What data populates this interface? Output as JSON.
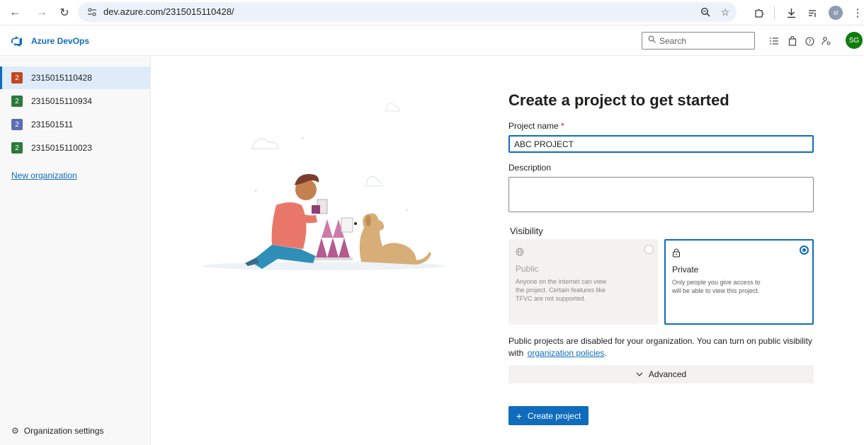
{
  "browser": {
    "url": "dev.azure.com/2315015110428/",
    "profile_initials": "sl"
  },
  "header": {
    "app_title": "Azure DevOps",
    "search_placeholder": "Search",
    "user_initials": "SG"
  },
  "sidebar": {
    "organizations": [
      {
        "badge": "2",
        "name": "2315015110428",
        "color": "#c3471f",
        "selected": true
      },
      {
        "badge": "2",
        "name": "2315015110934",
        "color": "#2b7a3b",
        "selected": false
      },
      {
        "badge": "2",
        "name": "231501511",
        "color": "#5c6db3",
        "selected": false
      },
      {
        "badge": "2",
        "name": "2315015110023",
        "color": "#2b7a3b",
        "selected": false
      }
    ],
    "new_org_label": "New organization",
    "settings_label": "Organization settings"
  },
  "form": {
    "title": "Create a project to get started",
    "project_name_label": "Project name",
    "required_marker": "*",
    "project_name_value": "ABC PROJECT",
    "description_label": "Description",
    "description_value": "",
    "visibility_label": "Visibility",
    "public": {
      "title": "Public",
      "description": "Anyone on the internet can view the project. Certain features like TFVC are not supported."
    },
    "private": {
      "title": "Private",
      "description": "Only people you give access to will be able to view this project."
    },
    "selected_visibility": "Private",
    "notice_text": "Public projects are disabled for your organization. You can turn on public visibility with",
    "notice_link": "organization policies",
    "notice_end": ".",
    "advanced_label": "Advanced",
    "create_label": "Create project"
  },
  "colors": {
    "accent": "#0f6cbd",
    "avatar": "#107c10"
  },
  "icons": {
    "back": "arrow-left-icon",
    "forward": "arrow-right-icon",
    "reload": "reload-icon",
    "lock": "lock-icon",
    "globe": "globe-icon"
  }
}
